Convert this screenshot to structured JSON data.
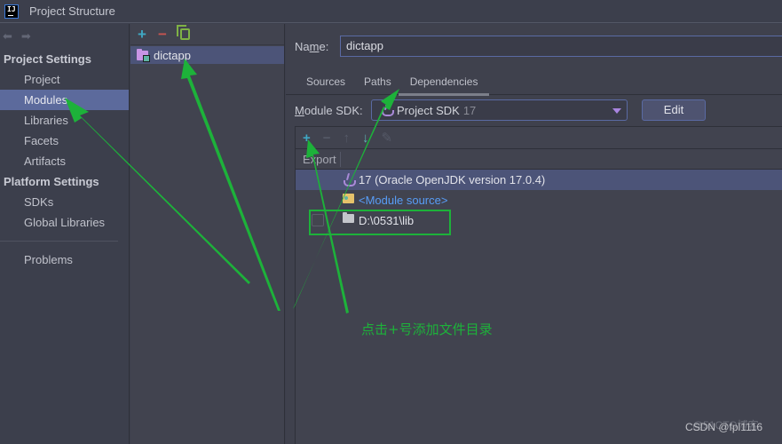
{
  "window": {
    "title": "Project Structure",
    "logo_text": "IJ"
  },
  "sidebar": {
    "nav_back": "back-arrow",
    "nav_forward": "forward-arrow",
    "sections": [
      {
        "header": "Project Settings",
        "items": [
          {
            "label": "Project",
            "selected": false
          },
          {
            "label": "Modules",
            "selected": true
          },
          {
            "label": "Libraries",
            "selected": false
          },
          {
            "label": "Facets",
            "selected": false
          },
          {
            "label": "Artifacts",
            "selected": false
          }
        ]
      },
      {
        "header": "Platform Settings",
        "items": [
          {
            "label": "SDKs",
            "selected": false
          },
          {
            "label": "Global Libraries",
            "selected": false
          }
        ]
      }
    ],
    "footer_item": "Problems"
  },
  "modules_panel": {
    "toolbar": {
      "add": "+",
      "remove": "−",
      "copy": "copy"
    },
    "modules": [
      {
        "name": "dictapp",
        "selected": true
      }
    ]
  },
  "detail": {
    "name_label": "Name:",
    "name_value": "dictapp",
    "tabs": [
      {
        "label": "Sources",
        "active": false
      },
      {
        "label": "Paths",
        "active": false
      },
      {
        "label": "Dependencies",
        "active": true
      }
    ],
    "sdk_label": "Module SDK:",
    "sdk_value": "Project SDK",
    "sdk_version": "17",
    "edit_button": "Edit",
    "deps_toolbar": {
      "add": "+",
      "remove": "−",
      "up": "↑",
      "down": "↓",
      "edit": "✎"
    },
    "deps_header": {
      "export": "Export"
    },
    "dependencies": [
      {
        "text": "17 (Oracle OpenJDK version 17.0.4)",
        "icon": "java-icon",
        "selected": true,
        "has_checkbox": false
      },
      {
        "text": "<Module source>",
        "icon": "module-source-icon",
        "selected": false,
        "has_checkbox": false,
        "link": true
      },
      {
        "text": "D:\\0531\\lib",
        "icon": "folder-icon",
        "selected": false,
        "has_checkbox": true,
        "checked": false
      }
    ]
  },
  "annotation": {
    "text": "点击+号添加文件目录",
    "color": "#1db23a"
  },
  "watermark": {
    "text": "CSDN @fpl1116",
    "text_faint": "@51CTO博客"
  },
  "colors": {
    "accent_selection": "#5c6a9c",
    "row_selection": "#4c5478",
    "input_border": "#5a6aa3",
    "annotation_green": "#1db23a",
    "link_blue": "#589df6"
  }
}
